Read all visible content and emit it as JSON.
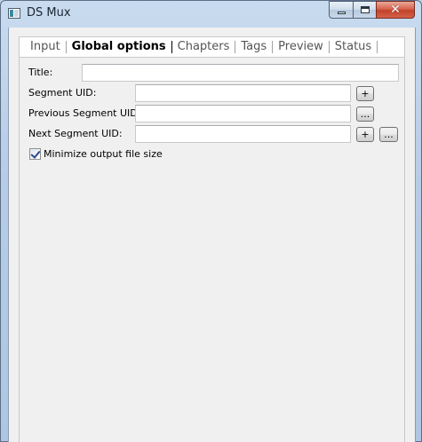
{
  "window": {
    "title": "DS Mux"
  },
  "tabs": [
    {
      "label": "Input",
      "active": false
    },
    {
      "label": "Global options",
      "active": true
    },
    {
      "label": "Chapters",
      "active": false
    },
    {
      "label": "Tags",
      "active": false
    },
    {
      "label": "Preview",
      "active": false
    },
    {
      "label": "Status",
      "active": false
    }
  ],
  "form": {
    "title_label": "Title:",
    "title_value": "",
    "segment_uid_label": "Segment UID:",
    "segment_uid_value": "",
    "segment_uid_add": "+",
    "prev_segment_uid_label": "Previous Segment UID:",
    "prev_segment_uid_value": "",
    "prev_segment_uid_browse": "...",
    "next_segment_uid_label": "Next Segment UID:",
    "next_segment_uid_value": "",
    "next_segment_uid_add": "+",
    "next_segment_uid_browse": "...",
    "minimize_label": "Minimize output file size",
    "minimize_checked": true
  },
  "icons": {
    "app": "app-window-icon",
    "minimize": "minimize-icon",
    "maximize": "maximize-icon",
    "close": "close-icon"
  }
}
